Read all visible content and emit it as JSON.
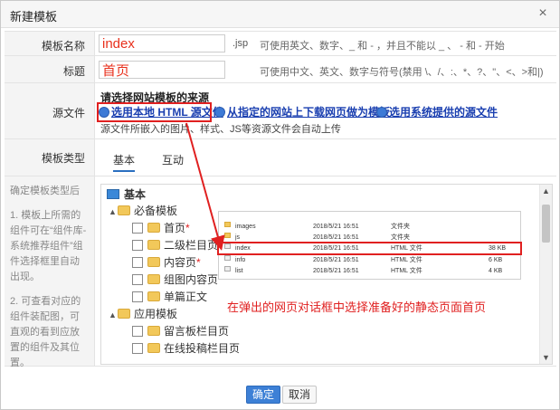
{
  "dialog": {
    "title": "新建模板",
    "close_icon": "×"
  },
  "form": {
    "template_name": {
      "label": "模板名称",
      "value": "index",
      "suffix": ".jsp",
      "hint": "可使用英文、数字、_ 和 - ，并且不能以 _ 、 - 和 - 开始"
    },
    "title": {
      "label": "标题",
      "value": "首页",
      "hint": "可使用中文、英文、数字与符号(禁用 \\、/、:、*、?、\"、<、>和|)"
    },
    "source": {
      "label": "源文件",
      "heading": "请选择网站模板的来源",
      "links": [
        "选用本地 HTML 源文件",
        "从指定的网站上下载网页做为模板",
        "选用系统提供的源文件"
      ],
      "note": "源文件所嵌入的图片、样式、JS等资源文件会自动上传"
    },
    "template_type": {
      "label": "模板类型",
      "tabs": [
        "基本",
        "互动"
      ]
    }
  },
  "sidebar_help": {
    "intro": "确定模板类型后",
    "tips": [
      "1. 模板上所需的组件可在“组件库-系统推荐组件”组件选择框里自动出现。",
      "2. 可查看对应的组件装配图，可直观的看到应放置的组件及其位置。"
    ]
  },
  "tree": {
    "root": "基本",
    "groups": [
      {
        "name": "必备模板",
        "items": [
          {
            "label": "首页",
            "required": true
          },
          {
            "label": "二级栏目页",
            "required": true
          },
          {
            "label": "内容页",
            "required": true
          },
          {
            "label": "组图内容页",
            "required": false
          },
          {
            "label": "单篇正文",
            "required": false
          }
        ]
      },
      {
        "name": "应用模板",
        "items": [
          {
            "label": "留言板栏目页",
            "required": false
          },
          {
            "label": "在线投稿栏目页",
            "required": false
          }
        ]
      }
    ],
    "required_mark": "*",
    "caret_down": "▲",
    "scroll_up": "▲",
    "scroll_down": "▼"
  },
  "file_dialog": {
    "files": [
      {
        "name": "images",
        "date": "2018/5/21 16:51",
        "type": "文件夹",
        "size": ""
      },
      {
        "name": "js",
        "date": "2018/5/21 16:51",
        "type": "文件夹",
        "size": ""
      },
      {
        "name": "index",
        "date": "2018/5/21 16:51",
        "type": "HTML 文件",
        "size": "38 KB"
      },
      {
        "name": "info",
        "date": "2018/5/21 16:51",
        "type": "HTML 文件",
        "size": "6 KB"
      },
      {
        "name": "list",
        "date": "2018/5/21 16:51",
        "type": "HTML 文件",
        "size": "4 KB"
      }
    ]
  },
  "annotation": "在弹出的网页对话框中选择准备好的静态页面首页",
  "footer": {
    "ok": "确定",
    "cancel": "取消"
  },
  "colors": {
    "accent": "#3d80d6",
    "highlight": "#e02020",
    "link": "#1a3fb0"
  }
}
